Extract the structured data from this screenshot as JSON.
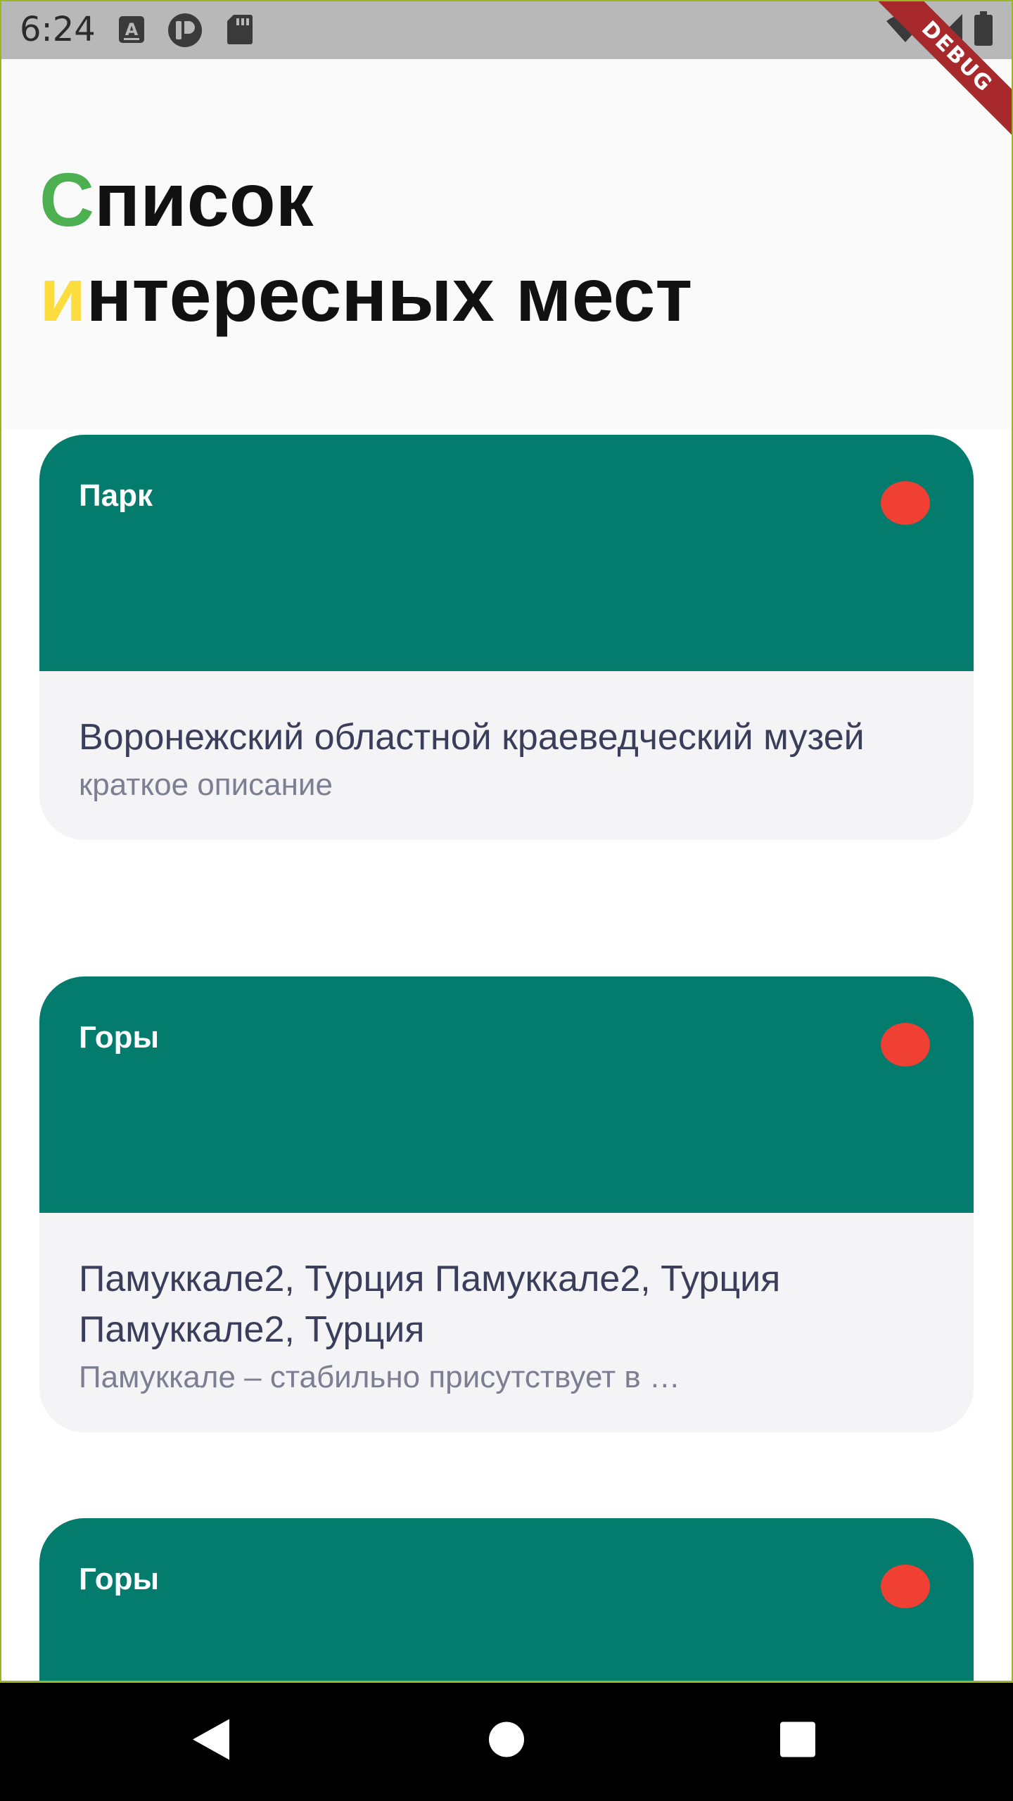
{
  "status_bar": {
    "time": "6:24",
    "left_icons": [
      "text-a-icon",
      "circle-p-icon",
      "sd-card-icon"
    ],
    "right_icons": [
      "wifi-icon",
      "signal-icon",
      "battery-icon"
    ]
  },
  "debug_banner": {
    "label": "DEBUG",
    "color": "#a8292c"
  },
  "header": {
    "title_line1_first": "С",
    "title_line1_rest": "писок",
    "title_line2_first": "и",
    "title_line2_rest": "нтересных мест",
    "accent_green": "#4caf50",
    "accent_yellow": "#fcdd3d"
  },
  "places": [
    {
      "type": "Парк",
      "name": "Воронежский областной краеведческий музей",
      "description": "краткое описание",
      "favorite_icon": "favorite-dot-icon"
    },
    {
      "type": "Горы",
      "name": "Памуккале2, Турция Памуккале2, Турция Памуккале2, Турция",
      "description": "Памуккале – стабильно присутствует в …",
      "favorite_icon": "favorite-dot-icon"
    },
    {
      "type": "Горы",
      "name": "",
      "description": "",
      "favorite_icon": "favorite-dot-icon"
    }
  ],
  "colors": {
    "card_header": "#037b6d",
    "card_body": "#f4f4f6",
    "favorite": "#f03f33",
    "name_text": "#3b3e5b",
    "desc_text": "#7c7e92"
  },
  "nav_bar": {
    "buttons": [
      "back-icon",
      "home-icon",
      "recents-icon"
    ]
  }
}
